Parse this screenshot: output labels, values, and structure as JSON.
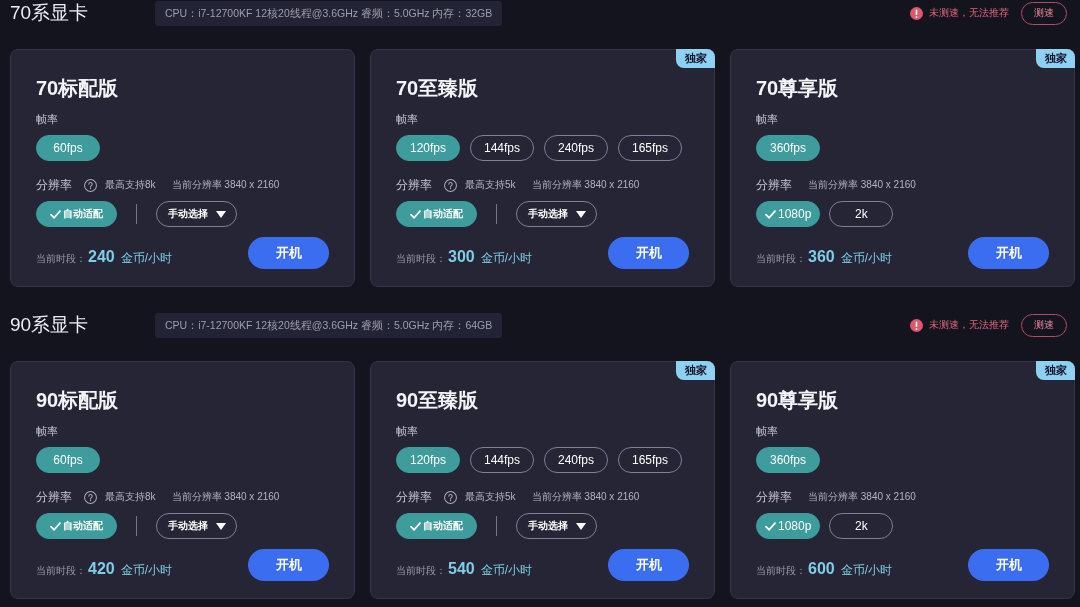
{
  "sections": [
    {
      "title": "70系显卡",
      "specs": "CPU：i7-12700KF 12核20线程@3.6GHz 睿频：5.0GHz 内存：32GB",
      "notice": "未测速，无法推荐",
      "test_button": "测速",
      "cards": [
        {
          "title": "70标配版",
          "fps_label": "帧率",
          "fps_options": [
            {
              "label": "60fps",
              "selected": true
            }
          ],
          "resolution_label": "分辨率",
          "help_icon": true,
          "max_support": "最高支持8k",
          "current_resolution": "当前分辨率 3840 x 2160",
          "resolution_options": [
            {
              "kind": "toggle",
              "label": "自动适配",
              "selected": true
            },
            {
              "kind": "dropdown",
              "label": "手动选择",
              "selected": false
            }
          ],
          "price_label": "当前时段：",
          "price": "240",
          "price_unit": "金币/小时",
          "button": "开机"
        },
        {
          "title": "70至臻版",
          "badge": "独家",
          "fps_label": "帧率",
          "fps_options": [
            {
              "label": "120fps",
              "selected": true
            },
            {
              "label": "144fps",
              "selected": false
            },
            {
              "label": "240fps",
              "selected": false
            },
            {
              "label": "165fps",
              "selected": false
            }
          ],
          "resolution_label": "分辨率",
          "help_icon": true,
          "max_support": "最高支持5k",
          "current_resolution": "当前分辨率 3840 x 2160",
          "resolution_options": [
            {
              "kind": "toggle",
              "label": "自动适配",
              "selected": true
            },
            {
              "kind": "dropdown",
              "label": "手动选择",
              "selected": false
            }
          ],
          "price_label": "当前时段：",
          "price": "300",
          "price_unit": "金币/小时",
          "button": "开机"
        },
        {
          "title": "70尊享版",
          "badge": "独家",
          "fps_label": "帧率",
          "fps_options": [
            {
              "label": "360fps",
              "selected": true
            }
          ],
          "resolution_label": "分辨率",
          "help_icon": false,
          "current_resolution": "当前分辨率 3840 x 2160",
          "resolution_options": [
            {
              "kind": "toggle",
              "label": "1080p",
              "selected": true
            },
            {
              "kind": "toggle",
              "label": "2k",
              "selected": false
            }
          ],
          "price_label": "当前时段：",
          "price": "360",
          "price_unit": "金币/小时",
          "button": "开机"
        }
      ]
    },
    {
      "title": "90系显卡",
      "specs": "CPU：i7-12700KF 12核20线程@3.6GHz 睿频：5.0GHz 内存：64GB",
      "notice": "未测速，无法推荐",
      "test_button": "测速",
      "cards": [
        {
          "title": "90标配版",
          "fps_label": "帧率",
          "fps_options": [
            {
              "label": "60fps",
              "selected": true
            }
          ],
          "resolution_label": "分辨率",
          "help_icon": true,
          "max_support": "最高支持8k",
          "current_resolution": "当前分辨率 3840 x 2160",
          "resolution_options": [
            {
              "kind": "toggle",
              "label": "自动适配",
              "selected": true
            },
            {
              "kind": "dropdown",
              "label": "手动选择",
              "selected": false
            }
          ],
          "price_label": "当前时段：",
          "price": "420",
          "price_unit": "金币/小时",
          "button": "开机"
        },
        {
          "title": "90至臻版",
          "badge": "独家",
          "fps_label": "帧率",
          "fps_options": [
            {
              "label": "120fps",
              "selected": true
            },
            {
              "label": "144fps",
              "selected": false
            },
            {
              "label": "240fps",
              "selected": false
            },
            {
              "label": "165fps",
              "selected": false
            }
          ],
          "resolution_label": "分辨率",
          "help_icon": true,
          "max_support": "最高支持5k",
          "current_resolution": "当前分辨率 3840 x 2160",
          "resolution_options": [
            {
              "kind": "toggle",
              "label": "自动适配",
              "selected": true
            },
            {
              "kind": "dropdown",
              "label": "手动选择",
              "selected": false
            }
          ],
          "price_label": "当前时段：",
          "price": "540",
          "price_unit": "金币/小时",
          "button": "开机"
        },
        {
          "title": "90尊享版",
          "badge": "独家",
          "fps_label": "帧率",
          "fps_options": [
            {
              "label": "360fps",
              "selected": true
            }
          ],
          "resolution_label": "分辨率",
          "help_icon": false,
          "current_resolution": "当前分辨率 3840 x 2160",
          "resolution_options": [
            {
              "kind": "toggle",
              "label": "1080p",
              "selected": true
            },
            {
              "kind": "toggle",
              "label": "2k",
              "selected": false
            }
          ],
          "price_label": "当前时段：",
          "price": "600",
          "price_unit": "金币/小时",
          "button": "开机"
        }
      ]
    }
  ]
}
